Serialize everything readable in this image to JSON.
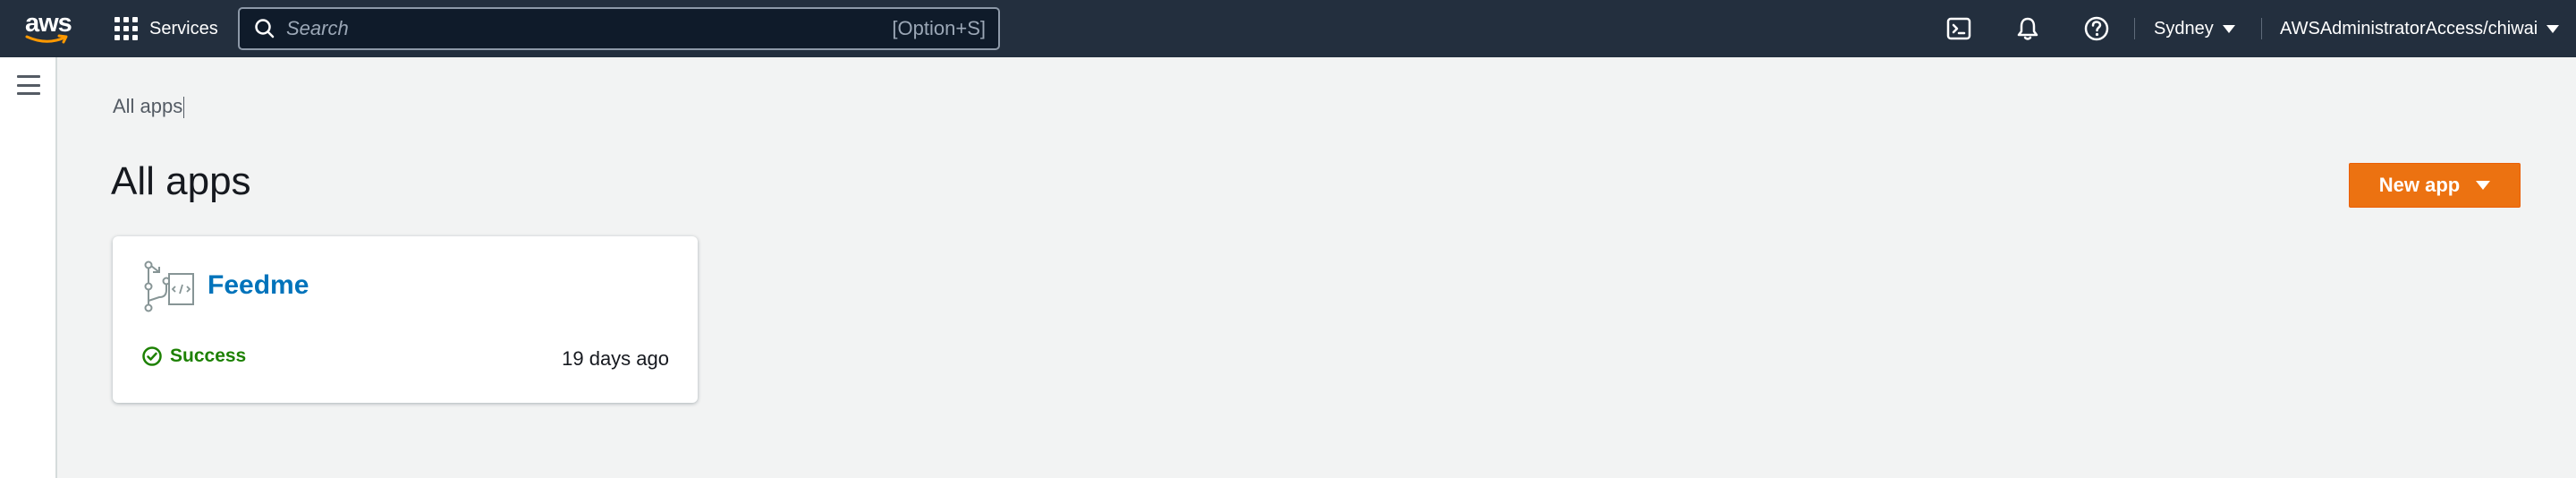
{
  "header": {
    "logo_text": "aws",
    "services_label": "Services",
    "search_placeholder": "Search",
    "search_shortcut": "[Option+S]",
    "region": "Sydney",
    "account": "AWSAdministratorAccess/chiwai",
    "icons": [
      "cloudshell-icon",
      "bell-icon",
      "help-icon"
    ]
  },
  "breadcrumb": "All apps",
  "page_title": "All apps",
  "new_app_button": "New app",
  "apps": [
    {
      "name": "Feedme",
      "status": "Success",
      "updated": "19 days ago"
    }
  ],
  "colors": {
    "nav_bg": "#232f3e",
    "primary_button": "#ec7211",
    "link": "#0073bb",
    "success": "#1d8102",
    "page_bg": "#f2f3f3"
  }
}
